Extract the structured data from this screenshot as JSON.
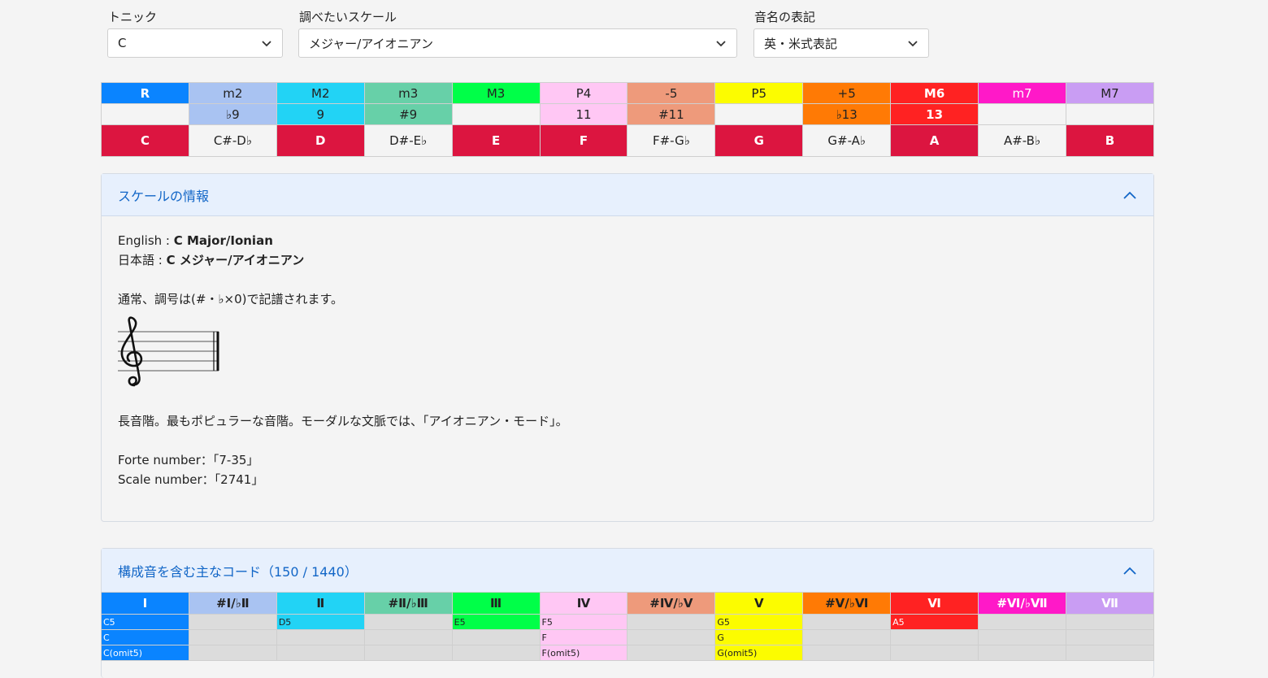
{
  "controls": {
    "tonic": {
      "label": "トニック",
      "value": "C"
    },
    "scale": {
      "label": "調べたいスケール",
      "value": "メジャー/アイオニアン"
    },
    "notation": {
      "label": "音名の表記",
      "value": "英・米式表記"
    }
  },
  "intervals": {
    "row1": [
      "R",
      "m2",
      "M2",
      "m3",
      "M3",
      "P4",
      "-5",
      "P5",
      "+5",
      "M6",
      "m7",
      "M7"
    ],
    "row2": [
      "",
      "♭9",
      "9",
      "#9",
      "",
      "11",
      "#11",
      "",
      "♭13",
      "13",
      "",
      ""
    ],
    "notes": [
      "C",
      "C#-D♭",
      "D",
      "D#-E♭",
      "E",
      "F",
      "F#-G♭",
      "G",
      "G#-A♭",
      "A",
      "A#-B♭",
      "B"
    ],
    "in_scale": [
      true,
      false,
      true,
      false,
      true,
      true,
      false,
      true,
      false,
      true,
      false,
      true
    ],
    "colors": [
      "#0a84ff",
      "#a9c3f2",
      "#22d3f5",
      "#67d0a8",
      "#00ff48",
      "#ffc7f4",
      "#ee9a7b",
      "#fcfc00",
      "#ff7a05",
      "#ff2222",
      "#ff19c8",
      "#c99df3"
    ],
    "note_active_color": "#dc1540"
  },
  "scale_info": {
    "title": "スケールの情報",
    "english_label": "English :",
    "english_value": "C Major/Ionian",
    "japanese_label": "日本語 :",
    "japanese_value": "C メジャー/アイオニアン",
    "key_sig": "通常、調号は(#・♭×0)で記譜されます。",
    "description": "長音階。最もポピュラーな音階。モーダルな文脈では、「アイオニアン・モード」。",
    "forte": "Forte number：「7-35」",
    "scale_number": "Scale number：「2741」"
  },
  "chords": {
    "title": "構成音を含む主なコード（150 / 1440）",
    "headers": [
      "Ⅰ",
      "#Ⅰ/♭Ⅱ",
      "Ⅱ",
      "#Ⅱ/♭Ⅲ",
      "Ⅲ",
      "Ⅳ",
      "#Ⅳ/♭Ⅴ",
      "Ⅴ",
      "#Ⅴ/♭Ⅵ",
      "Ⅵ",
      "#Ⅵ/♭Ⅶ",
      "Ⅶ"
    ],
    "header_text_colors": [
      "#ffffff",
      "#222222",
      "#222222",
      "#222222",
      "#222222",
      "#222222",
      "#222222",
      "#222222",
      "#222222",
      "#ffffff",
      "#ffffff",
      "#ffffff"
    ],
    "rows": [
      [
        "C5",
        "",
        "D5",
        "",
        "E5",
        "F5",
        "",
        "G5",
        "",
        "A5",
        "",
        ""
      ],
      [
        "C",
        "",
        "",
        "",
        "",
        "F",
        "",
        "G",
        "",
        "",
        "",
        ""
      ],
      [
        "C(omit5)",
        "",
        "",
        "",
        "",
        "F(omit5)",
        "",
        "G(omit5)",
        "",
        "",
        "",
        ""
      ]
    ]
  }
}
